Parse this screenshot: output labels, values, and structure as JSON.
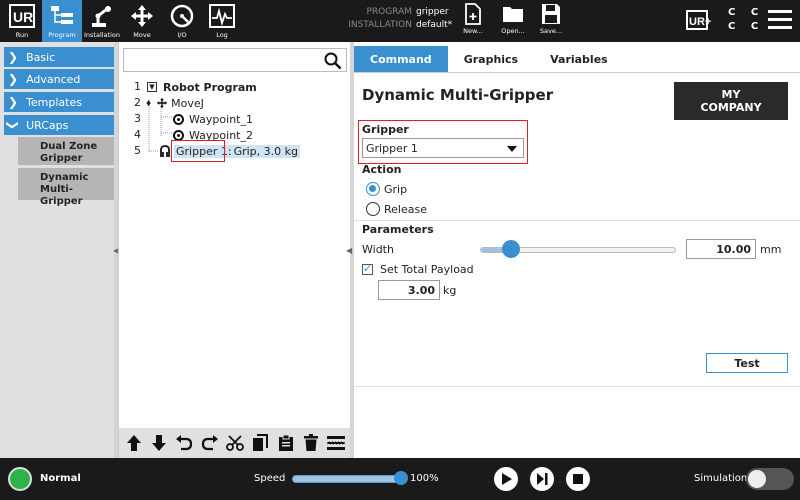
{
  "topbar": {
    "nav": [
      {
        "label": "Run",
        "icon": "ur-logo-icon"
      },
      {
        "label": "Program",
        "icon": "program-tree-icon"
      },
      {
        "label": "Installation",
        "icon": "robot-arm-icon"
      },
      {
        "label": "Move",
        "icon": "move-arrows-icon"
      },
      {
        "label": "I/O",
        "icon": "io-gauge-icon"
      },
      {
        "label": "Log",
        "icon": "log-chart-icon"
      }
    ],
    "program_key": "PROGRAM",
    "program_value": "gripper",
    "installation_key": "INSTALLATION",
    "installation_value": "default*",
    "file_buttons": [
      {
        "label": "New...",
        "icon": "new-file-icon"
      },
      {
        "label": "Open...",
        "icon": "open-folder-icon"
      },
      {
        "label": "Save...",
        "icon": "save-disk-icon"
      }
    ],
    "urplus": "UR+",
    "cc_line1": "C C",
    "cc_line2": "C C",
    "accent": "#3a8fd0"
  },
  "left": {
    "sections": [
      {
        "label": "Basic",
        "icon": "chevron-right-icon"
      },
      {
        "label": "Advanced",
        "icon": "chevron-right-icon"
      },
      {
        "label": "Templates",
        "icon": "chevron-right-icon"
      },
      {
        "label": "URCaps",
        "icon": "chevron-down-icon"
      }
    ],
    "urcaps": [
      {
        "label": "Dual Zone Gripper"
      },
      {
        "label": "Dynamic Multi-Gripper"
      }
    ]
  },
  "tree": {
    "search_placeholder": "",
    "nums": [
      "1",
      "2",
      "3",
      "4",
      "5"
    ],
    "root": "Robot Program",
    "movej": "MoveJ",
    "waypoint1": "Waypoint_1",
    "waypoint2": "Waypoint_2",
    "gripper_name": "Gripper 1:",
    "gripper_detail": " Grip, 3.0 kg"
  },
  "tabs": [
    {
      "label": "Command"
    },
    {
      "label": "Graphics"
    },
    {
      "label": "Variables"
    }
  ],
  "command": {
    "title": "Dynamic Multi-Gripper",
    "logo_line1": "MY",
    "logo_line2": "COMPANY",
    "gripper_label": "Gripper",
    "gripper_selected": "Gripper 1",
    "action_label": "Action",
    "grip_label": "Grip",
    "release_label": "Release",
    "selected_action": "Grip",
    "params_label": "Parameters",
    "width_label": "Width",
    "width_value": "10.00",
    "width_unit": "mm",
    "width_slider_fraction": 0.16,
    "payload_label": "Set Total Payload",
    "payload_checked": true,
    "payload_value": "3.00",
    "payload_unit": "kg",
    "test_label": "Test"
  },
  "bottombar": {
    "status": "Normal",
    "status_color": "#2db34a",
    "speed_label": "Speed",
    "speed_value": "100%",
    "speed_fraction": 1.0,
    "simulation_label": "Simulation",
    "simulation_on": false
  }
}
